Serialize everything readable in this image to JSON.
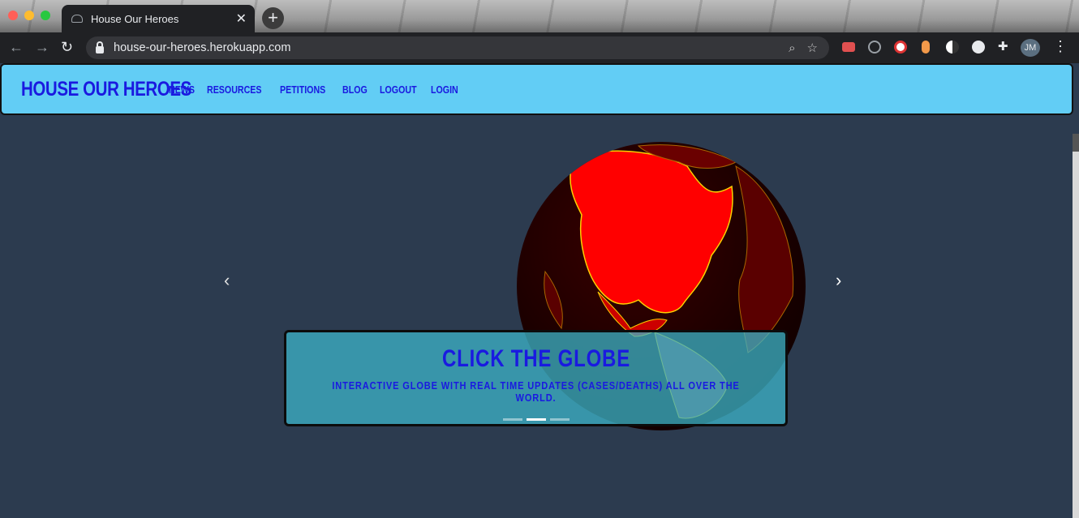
{
  "browser": {
    "tab_title": "House Our Heroes",
    "tab_close": "✕",
    "new_tab": "+",
    "url": "house-our-heroes.herokuapp.com",
    "profile_initials": "JM",
    "icons": [
      "back-icon",
      "forward-icon",
      "reload-icon",
      "lock-icon",
      "zoom-icon",
      "star-icon",
      "extensions-icon",
      "menu-icon"
    ]
  },
  "site": {
    "brand": "HOUSE OUR HEROES",
    "nav": [
      "NEWS",
      "RESOURCES",
      "PETITIONS",
      "BLOG",
      "LOGOUT",
      "LOGIN"
    ]
  },
  "carousel": {
    "heading": "CLICK THE GLOBE",
    "subtext": "INTERACTIVE GLOBE WITH REAL TIME UPDATES (CASES/DEATHS) ALL OVER THE WORLD.",
    "prev": "‹",
    "next": "›",
    "slide_count": 3,
    "active_slide": 2
  },
  "colors": {
    "nav_bg": "#62cdf5",
    "brand_blue": "#1a1ae0",
    "page_bg": "#2c3b4f",
    "globe_red": "#ff0000"
  }
}
